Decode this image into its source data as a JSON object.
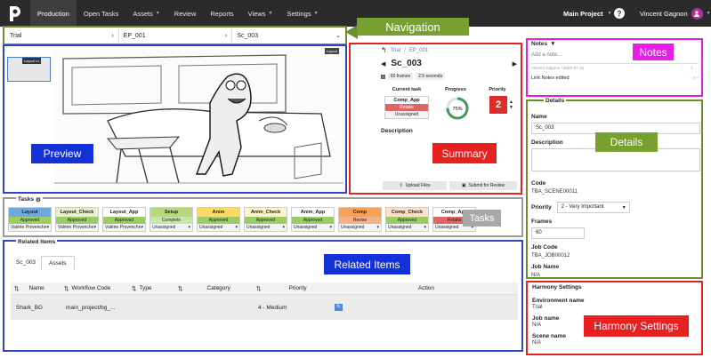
{
  "topbar": {
    "nav": [
      "Production",
      "Open Tasks",
      "Assets",
      "Review",
      "Reports",
      "Views",
      "Settings"
    ],
    "project": "Main Project",
    "user": "Vincent Gagnon",
    "help": "?"
  },
  "crumbs": [
    "Trial",
    "EP_001",
    "Sc_003"
  ],
  "callouts": {
    "navigation": "Navigation",
    "preview": "Preview",
    "summary": "Summary",
    "notes": "Notes",
    "details": "Details",
    "tasks": "Tasks",
    "related": "Related Items",
    "harmony": "Harmony Settings"
  },
  "preview": {
    "thumb_label": "Layout v1",
    "layout_tag": "Layout"
  },
  "summary": {
    "crumb_trial": "Trial",
    "crumb_ep": "EP_001",
    "title": "Sc_003",
    "frames": "60 frames",
    "seconds": "2.5 seconds",
    "current_task_label": "Current task",
    "progress_label": "Progress",
    "priority_label": "Priority",
    "current_task": "Comp_App",
    "task_status": "Retake",
    "task_assignee": "Unassigned",
    "progress": "75%",
    "priority": "2",
    "description_label": "Description",
    "upload": "Upload Files",
    "submit": "Submit for Review"
  },
  "notes": {
    "title": "Notes",
    "placeholder": "Add a note...",
    "meta": "Vincent Gagnon / 2021-07-16",
    "entry": "Link Notes edited"
  },
  "details": {
    "title": "Details",
    "name_label": "Name",
    "name_value": "Sc_003",
    "description_label": "Description",
    "code_label": "Code",
    "code_value": "TBA_SCENE00011",
    "priority_label": "Priority",
    "priority_value": "2 - Very Important",
    "frames_label": "Frames",
    "frames_value": "60",
    "jobcode_label": "Job Code",
    "jobcode_value": "TBA_JOB00012",
    "jobname_label": "Job Name",
    "jobname_value": "N/A"
  },
  "harmony": {
    "title": "Harmony Settings",
    "env_label": "Environment name",
    "env_value": "Trial",
    "job_label": "Job name",
    "job_value": "N/A",
    "scene_label": "Scene name",
    "scene_value": "N/A"
  },
  "tasks": {
    "title": "Tasks",
    "items": [
      {
        "name": "Layout",
        "status": "Approved",
        "assignee": "Valérie Provencher",
        "color": "#6fa8dc",
        "status_color": "#9ccc65"
      },
      {
        "name": "Layout_Check",
        "status": "Approved",
        "assignee": "Valérie Provencher",
        "color": "#e9f0d0",
        "status_color": "#9ccc65"
      },
      {
        "name": "Layout_App",
        "status": "Approved",
        "assignee": "Valérie Provencher",
        "color": "#ffffff",
        "status_color": "#9ccc65"
      },
      {
        "name": "Setup",
        "status": "Complete",
        "assignee": "Unassigned",
        "color": "#b7d97e",
        "status_color": "#c8e6a8"
      },
      {
        "name": "Anim",
        "status": "Approved",
        "assignee": "Unassigned",
        "color": "#ffd966",
        "status_color": "#9ccc65"
      },
      {
        "name": "Anim_Check",
        "status": "Approved",
        "assignee": "Unassigned",
        "color": "#fff2cc",
        "status_color": "#9ccc65"
      },
      {
        "name": "Anim_App",
        "status": "Approved",
        "assignee": "Unassigned",
        "color": "#ffffff",
        "status_color": "#9ccc65"
      },
      {
        "name": "Comp",
        "status": "Revise",
        "assignee": "Unassigned",
        "color": "#f6a05a",
        "status_color": "#f4b183"
      },
      {
        "name": "Comp_Check",
        "status": "Approved",
        "assignee": "Unassigned",
        "color": "#fde0c8",
        "status_color": "#9ccc65"
      },
      {
        "name": "Comp_App",
        "status": "Retake",
        "assignee": "Unassigned",
        "color": "#ffffff",
        "status_color": "#e06666"
      }
    ]
  },
  "related": {
    "title": "Related Items",
    "tabs": [
      "Sc_003",
      "Assets"
    ],
    "columns": [
      "Name",
      "Workflow Code",
      "Type",
      "Category",
      "Priority",
      "Action"
    ],
    "rows": [
      {
        "name": "Shark_BG",
        "workflow": "main_project/bg_...",
        "type": "",
        "category": "",
        "priority": "4 - Medium"
      }
    ]
  }
}
